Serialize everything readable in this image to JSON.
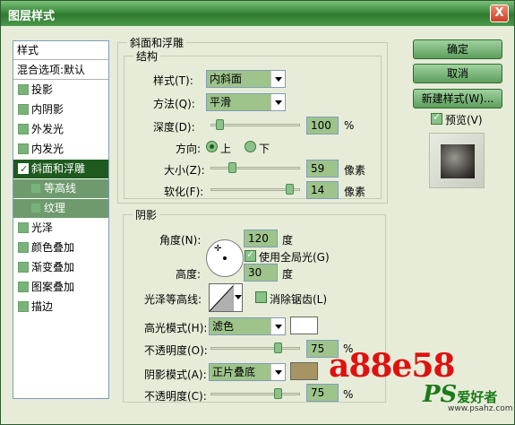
{
  "window": {
    "title": "图层样式",
    "close_label": "X"
  },
  "left_list": {
    "header": "样式",
    "blend_options": "混合选项:默认",
    "items": [
      {
        "label": "投影",
        "checked": false
      },
      {
        "label": "内阴影",
        "checked": false
      },
      {
        "label": "外发光",
        "checked": false
      },
      {
        "label": "内发光",
        "checked": false
      },
      {
        "label": "斜面和浮雕",
        "checked": true,
        "selected": true
      },
      {
        "label": "等高线",
        "checked": false,
        "sub": true
      },
      {
        "label": "纹理",
        "checked": false,
        "sub": true
      },
      {
        "label": "光泽",
        "checked": false
      },
      {
        "label": "颜色叠加",
        "checked": false
      },
      {
        "label": "渐变叠加",
        "checked": false
      },
      {
        "label": "图案叠加",
        "checked": false
      },
      {
        "label": "描边",
        "checked": false
      }
    ]
  },
  "bevel": {
    "group_title": "斜面和浮雕",
    "structure_title": "结构",
    "style_label": "样式(T):",
    "style_value": "内斜面",
    "technique_label": "方法(Q):",
    "technique_value": "平滑",
    "depth_label": "深度(D):",
    "depth_value": "100",
    "depth_unit": "%",
    "depth_fraction": 0.1,
    "direction_label": "方向:",
    "direction_up": "上",
    "direction_down": "下",
    "size_label": "大小(Z):",
    "size_value": "59",
    "size_unit": "像素",
    "size_fraction": 0.24,
    "soften_label": "软化(F):",
    "soften_value": "14",
    "soften_unit": "像素",
    "soften_fraction": 0.88
  },
  "shading": {
    "group_title": "阴影",
    "angle_label": "角度(N):",
    "angle_value": "120",
    "angle_unit": "度",
    "global_light_label": "使用全局光(G)",
    "global_light_checked": true,
    "altitude_label": "高度:",
    "altitude_value": "30",
    "altitude_unit": "度",
    "gloss_contour_label": "光泽等高线:",
    "antialiased_label": "消除锯齿(L)",
    "antialiased_checked": false,
    "highlight_mode_label": "高光模式(H):",
    "highlight_mode_value": "滤色",
    "highlight_color": "#ffffff",
    "highlight_opacity_label": "不透明度(O):",
    "highlight_opacity_value": "75",
    "highlight_opacity_unit": "%",
    "highlight_opacity_fraction": 0.75,
    "shadow_mode_label": "阴影模式(A):",
    "shadow_mode_value": "正片叠底",
    "shadow_color": "#a89462",
    "shadow_opacity_label": "不透明度(C):",
    "shadow_opacity_value": "75",
    "shadow_opacity_unit": "%",
    "shadow_opacity_fraction": 0.75
  },
  "buttons": {
    "ok": "确定",
    "cancel": "取消",
    "new_style": "新建样式(W)...",
    "preview_label": "预览(V)",
    "preview_checked": true
  },
  "overlay": {
    "watermark": "a88e58",
    "logo_ps": "PS",
    "logo_cn": "爱好者",
    "logo_url": "www.psahz.com"
  }
}
